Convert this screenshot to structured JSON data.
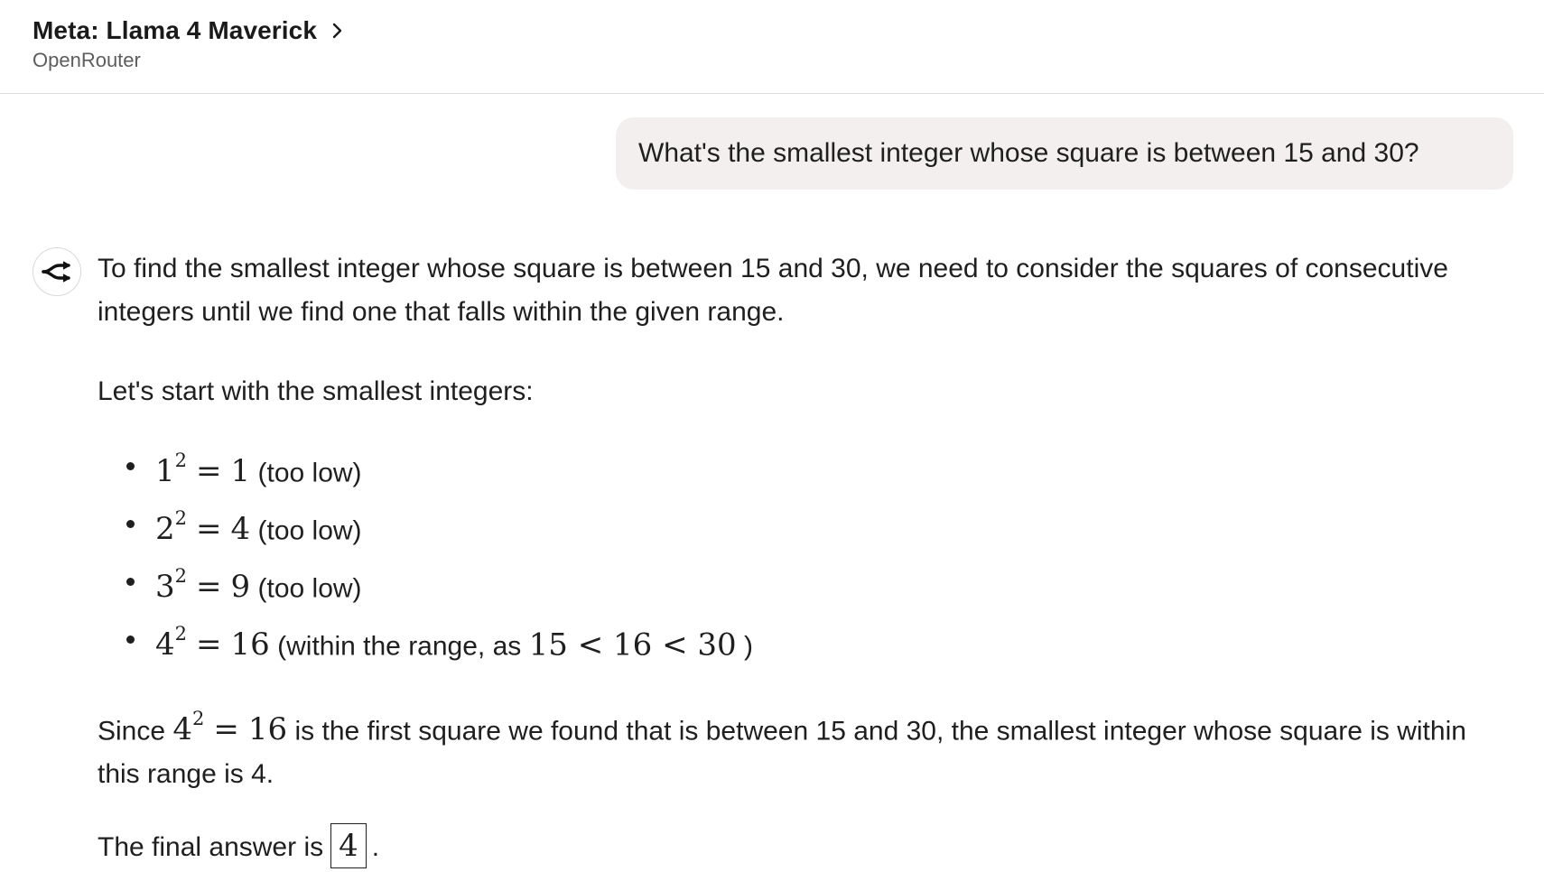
{
  "header": {
    "model_name": "Meta: Llama 4 Maverick",
    "provider": "OpenRouter"
  },
  "user_message": "What's the smallest integer whose square is between 15 and 30?",
  "assistant": {
    "intro": "To find the smallest integer whose square is between 15 and 30, we need to consider the squares of consecutive integers until we find one that falls within the given range.",
    "start": "Let's start with the smallest integers:",
    "items": [
      {
        "base": "1",
        "exp": "2",
        "eq": "=",
        "result": "1",
        "note": "(too low)"
      },
      {
        "base": "2",
        "exp": "2",
        "eq": "=",
        "result": "4",
        "note": "(too low)"
      },
      {
        "base": "3",
        "exp": "2",
        "eq": "=",
        "result": "9",
        "note": "(too low)"
      },
      {
        "base": "4",
        "exp": "2",
        "eq": "=",
        "result": "16",
        "note": "(within the range, as",
        "note_math": "15 < 16 < 30",
        "note_end": ")"
      }
    ],
    "since": {
      "lead": "Since",
      "base": "4",
      "exp": "2",
      "eq": "=",
      "result": "16",
      "text": "is the first square we found that is between 15 and 30, the smallest integer whose square is within this range is 4."
    },
    "final": {
      "lead": "The final answer is",
      "answer": "4",
      "end": "."
    }
  }
}
